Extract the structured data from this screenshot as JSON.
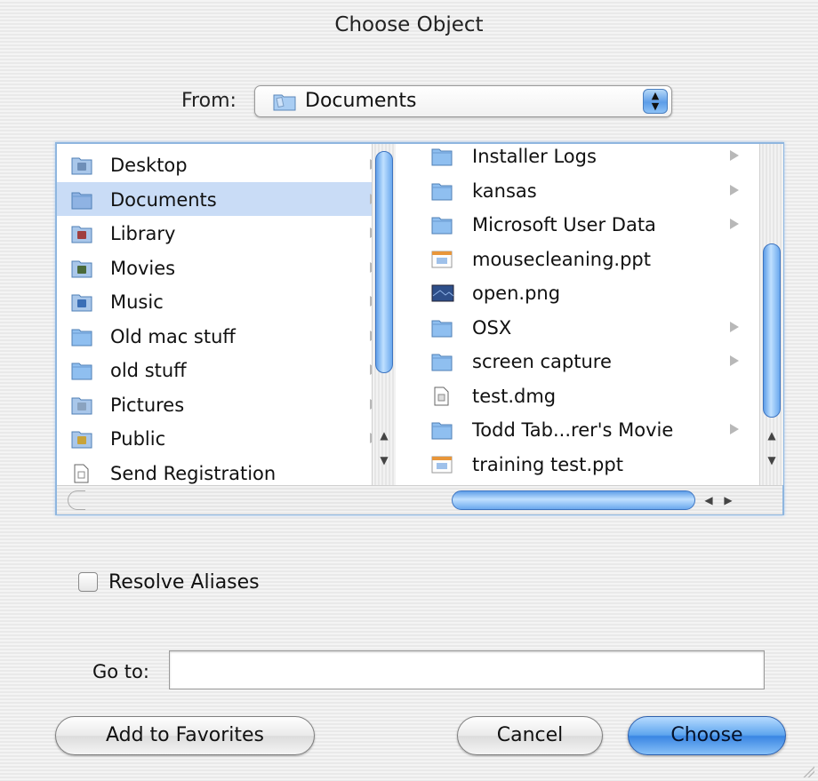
{
  "window": {
    "title": "Choose Object"
  },
  "from": {
    "label": "From:",
    "selected": "Documents",
    "icon": "folder-icon"
  },
  "column1": {
    "items": [
      {
        "label": "Desktop",
        "icon": "desktop-icon",
        "color": "#6f8fb8"
      },
      {
        "label": "Documents",
        "icon": "folder-icon",
        "color": "#8fb3e3"
      },
      {
        "label": "Library",
        "icon": "library-icon",
        "color": "#a04040"
      },
      {
        "label": "Movies",
        "icon": "movies-icon",
        "color": "#4a6a3a"
      },
      {
        "label": "Music",
        "icon": "music-icon",
        "color": "#3b6fb6"
      },
      {
        "label": "Old mac stuff",
        "icon": "folder-icon",
        "color": "#8fbff0"
      },
      {
        "label": "old stuff",
        "icon": "folder-icon",
        "color": "#8fbff0"
      },
      {
        "label": "Pictures",
        "icon": "pictures-icon",
        "color": "#8aa3c0"
      },
      {
        "label": "Public",
        "icon": "public-icon",
        "color": "#c8a33a"
      },
      {
        "label": "Send Registration",
        "icon": "document-icon",
        "color": "#ffffff"
      }
    ],
    "selected_index": 1
  },
  "column2": {
    "items": [
      {
        "label": "Installer Logs",
        "icon": "folder-icon",
        "color": "#8fbff0",
        "has_arrow": true
      },
      {
        "label": "kansas",
        "icon": "folder-icon",
        "color": "#8fbff0",
        "has_arrow": true
      },
      {
        "label": "Microsoft User Data",
        "icon": "folder-icon",
        "color": "#8fbff0",
        "has_arrow": true
      },
      {
        "label": "mousecleaning.ppt",
        "icon": "powerpoint-file-icon",
        "color": "#e8963a",
        "has_arrow": false
      },
      {
        "label": "open.png",
        "icon": "image-file-icon",
        "color": "#2e4f8a",
        "has_arrow": false
      },
      {
        "label": "OSX",
        "icon": "folder-icon",
        "color": "#8fbff0",
        "has_arrow": true
      },
      {
        "label": "screen capture",
        "icon": "folder-icon",
        "color": "#8fbff0",
        "has_arrow": true
      },
      {
        "label": "test.dmg",
        "icon": "disk-image-icon",
        "color": "#dddddd",
        "has_arrow": false
      },
      {
        "label": "Todd Tab...rer's Movie",
        "icon": "folder-icon",
        "color": "#8fbff0",
        "has_arrow": true
      },
      {
        "label": "training test.ppt",
        "icon": "powerpoint-file-icon",
        "color": "#e8963a",
        "has_arrow": false
      }
    ]
  },
  "options": {
    "resolve_aliases_label": "Resolve Aliases",
    "resolve_aliases_checked": false
  },
  "goto": {
    "label": "Go to:",
    "value": ""
  },
  "buttons": {
    "add_favorites": "Add to Favorites",
    "cancel": "Cancel",
    "choose": "Choose"
  },
  "scrollbars": {
    "arrow_up": "▲",
    "arrow_down": "▼",
    "arrow_left": "◀",
    "arrow_right": "▶"
  },
  "theme": {
    "accent": "#3a86e3",
    "selection": "#c9dcf6"
  }
}
